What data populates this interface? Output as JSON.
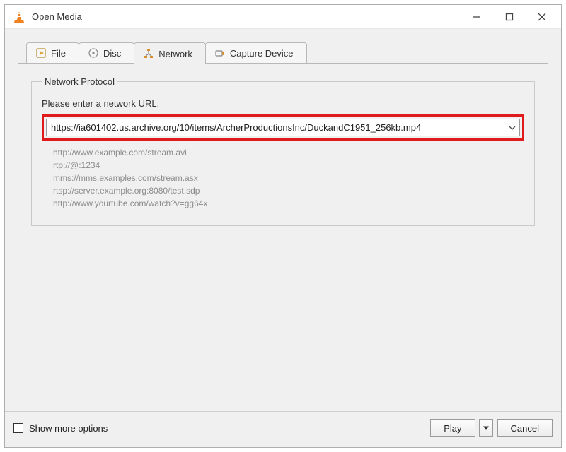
{
  "title": "Open Media",
  "tabs": {
    "file": {
      "label": "File"
    },
    "disc": {
      "label": "Disc"
    },
    "network": {
      "label": "Network"
    },
    "capture": {
      "label": "Capture Device"
    }
  },
  "network_panel": {
    "group_label": "Network Protocol",
    "prompt": "Please enter a network URL:",
    "url_value": "https://ia601402.us.archive.org/10/items/ArcherProductionsInc/DuckandC1951_256kb.mp4",
    "examples": [
      "http://www.example.com/stream.avi",
      "rtp://@:1234",
      "mms://mms.examples.com/stream.asx",
      "rtsp://server.example.org:8080/test.sdp",
      "http://www.yourtube.com/watch?v=gg64x"
    ]
  },
  "footer": {
    "show_more_label": "Show more options",
    "play_label": "Play",
    "cancel_label": "Cancel"
  }
}
